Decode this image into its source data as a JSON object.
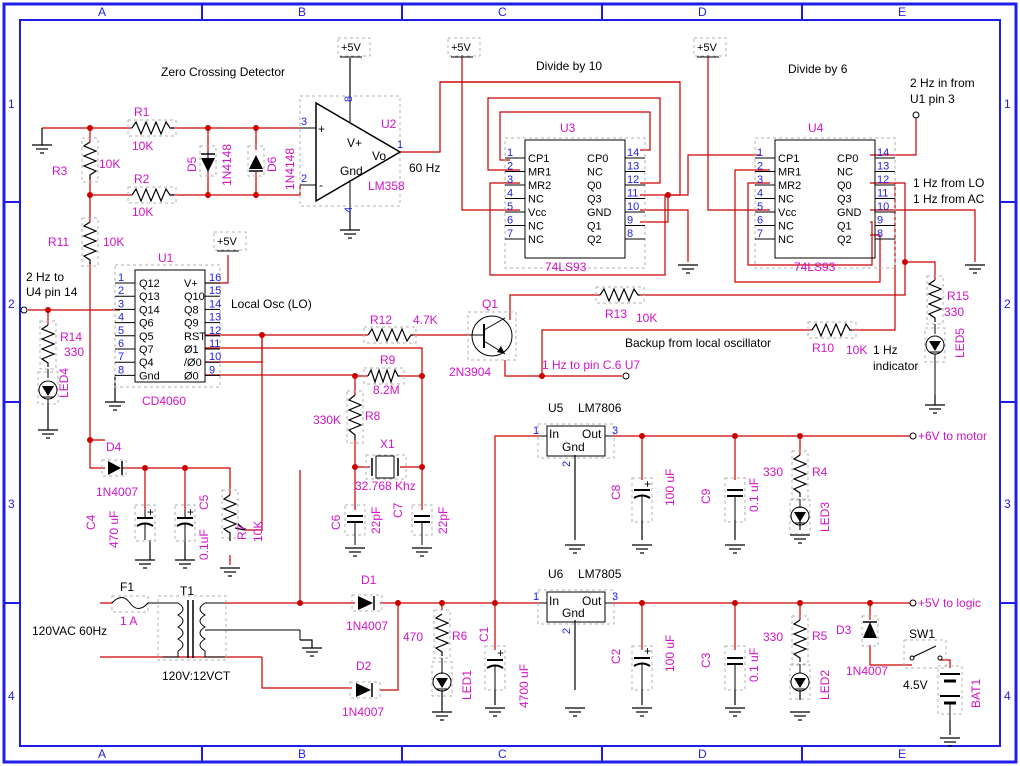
{
  "colors": {
    "frame": "#1e1ee8",
    "wire": "#cc0000",
    "label": "#d214c8",
    "pin": "#1e1ee8",
    "text": "#000000"
  },
  "grid": {
    "cols": [
      "A",
      "B",
      "C",
      "D",
      "E"
    ],
    "rows": [
      "1",
      "2",
      "3",
      "4"
    ]
  },
  "titles": {
    "zero_crossing": "Zero Crossing Detector",
    "divide10": "Divide by 10",
    "divide6": "Divide by 6",
    "local_osc": "Local Osc (LO)",
    "hz60": "60 Hz",
    "in2hz_a": "2 Hz in from",
    "in2hz_b": "U1 pin 3",
    "lo1hz": "1 Hz from LO",
    "ac1hz": "1 Hz from AC",
    "to_u4_a": "2 Hz to",
    "to_u4_b": "U4 pin 14",
    "backup": "Backup from local oscillator",
    "to_u7": "1 Hz to pin C.6 U7",
    "ind_a": "1 Hz",
    "ind_b": "indicator",
    "mains": "120VAC 60Hz",
    "xfmr": "120V:12VCT",
    "v45": "4.5V",
    "to_motor": "+6V to motor",
    "to_logic": "+5V to logic"
  },
  "supplies": [
    "+5V",
    "+5V",
    "+5V",
    "+5V"
  ],
  "components": {
    "R1": [
      "R1",
      "10K"
    ],
    "R2": [
      "R2",
      "10K"
    ],
    "R3": [
      "R3",
      "10K"
    ],
    "R11": [
      "R11",
      "10K"
    ],
    "R12": [
      "R12",
      "4.7K"
    ],
    "R13": [
      "R13",
      "10K"
    ],
    "R10": [
      "R10",
      "10K"
    ],
    "R9": [
      "R9",
      "8.2M"
    ],
    "R8": [
      "R8",
      "330K"
    ],
    "R7": [
      "R7",
      "10K"
    ],
    "R14": [
      "R14",
      "330"
    ],
    "R15": [
      "R15",
      "330"
    ],
    "R6": [
      "R6",
      "470"
    ],
    "R4": [
      "R4",
      "330"
    ],
    "R5": [
      "R5",
      "330"
    ],
    "D5": [
      "D5",
      "1N4148"
    ],
    "D6": [
      "D6",
      "1N4148"
    ],
    "D4": [
      "D4",
      "1N4007"
    ],
    "D1": [
      "D1",
      "1N4007"
    ],
    "D2": [
      "D2",
      "1N4007"
    ],
    "D3": [
      "D3",
      "1N4007"
    ],
    "C4": [
      "C4",
      "470 uF"
    ],
    "C5": [
      "C5",
      "0.1uF"
    ],
    "C6": [
      "C6",
      "22pF"
    ],
    "C7": [
      "C7",
      "22pF"
    ],
    "C1": [
      "C1",
      "4700 uF"
    ],
    "C8": [
      "C8",
      "100 uF"
    ],
    "C9": [
      "C9",
      "0.1 uF"
    ],
    "C2": [
      "C2",
      "100 uF"
    ],
    "C3": [
      "C3",
      "0.1 uF"
    ],
    "X1": [
      "X1",
      "32.768 Khz"
    ],
    "Q1": [
      "Q1",
      "2N3904"
    ],
    "U2": [
      "U2",
      "LM358"
    ],
    "U3": [
      "U3",
      "74LS93"
    ],
    "U4": [
      "U4",
      "74LS93"
    ],
    "U1": [
      "U1",
      "CD4060"
    ],
    "U5": [
      "U5",
      "LM7806"
    ],
    "U6": [
      "U6",
      "LM7805"
    ],
    "F1": [
      "F1",
      "1 A"
    ],
    "T1": [
      "T1"
    ],
    "SW1": [
      "SW1"
    ],
    "BAT1": [
      "BAT1"
    ],
    "LED1": [
      "LED1"
    ],
    "LED2": [
      "LED2"
    ],
    "LED3": [
      "LED3"
    ],
    "LED4": [
      "LED4"
    ],
    "LED5": [
      "LED5"
    ]
  },
  "opamp": {
    "plus": "+",
    "minus": "-",
    "vp": "V+",
    "vo": "Vo",
    "gnd": "Gnd",
    "p3": "3",
    "p2": "2",
    "p1": "1",
    "p8": "8",
    "p4": "4"
  },
  "ls93": {
    "left_names": [
      "CP1",
      "MR1",
      "MR2",
      "NC",
      "Vcc",
      "NC",
      "NC"
    ],
    "left_pins": [
      "1",
      "2",
      "3",
      "4",
      "5",
      "6",
      "7"
    ],
    "right_names": [
      "CP0",
      "NC",
      "Q0",
      "Q3",
      "GND",
      "Q1",
      "Q2"
    ],
    "right_pins": [
      "14",
      "13",
      "12",
      "11",
      "10",
      "9",
      "8"
    ]
  },
  "cd4060": {
    "left_names": [
      "Q12",
      "Q13",
      "Q14",
      "Q6",
      "Q5",
      "Q7",
      "Q4",
      "Gnd"
    ],
    "left_pins": [
      "1",
      "2",
      "3",
      "4",
      "5",
      "6",
      "7",
      "8"
    ],
    "right_names": [
      "V+",
      "Q10",
      "Q8",
      "Q9",
      "RST",
      "Ø1",
      "/Ø0",
      "Ø0"
    ],
    "right_pins": [
      "16",
      "15",
      "14",
      "13",
      "12",
      "11",
      "10",
      "9"
    ]
  },
  "reg": {
    "in": "In",
    "out": "Out",
    "gnd": "Gnd",
    "p1": "1",
    "p2": "2",
    "p3": "3"
  },
  "transistor_pins": [
    "1",
    "2",
    "3"
  ]
}
